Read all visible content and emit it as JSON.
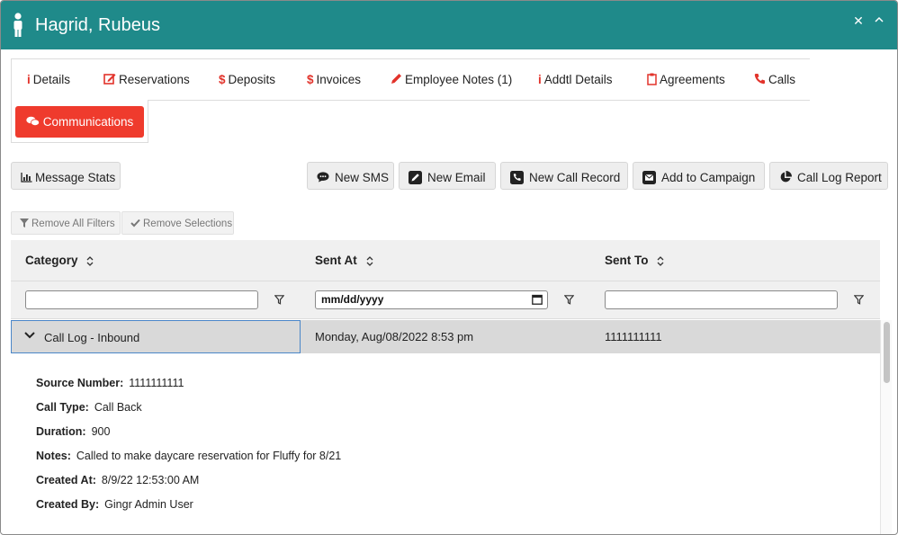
{
  "header": {
    "title": "Hagrid, Rubeus"
  },
  "tabs": [
    {
      "label": "Details",
      "icon": "info-icon"
    },
    {
      "label": "Reservations",
      "icon": "edit-icon"
    },
    {
      "label": "Deposits",
      "icon": "dollar-icon"
    },
    {
      "label": "Invoices",
      "icon": "dollar-icon"
    },
    {
      "label": "Employee Notes (1)",
      "icon": "pencil-icon"
    },
    {
      "label": "Addtl Details",
      "icon": "info-icon"
    },
    {
      "label": "Agreements",
      "icon": "clipboard-icon"
    },
    {
      "label": "Calls",
      "icon": "phone-icon"
    },
    {
      "label": "Communications",
      "icon": "comments-icon",
      "active": true
    }
  ],
  "toolbar": {
    "message_stats": "Message Stats",
    "new_sms": "New SMS",
    "new_email": "New Email",
    "new_call_record": "New Call Record",
    "add_to_campaign": "Add to Campaign",
    "call_log_report": "Call Log Report"
  },
  "filters": {
    "remove_all": "Remove All Filters",
    "remove_selections": "Remove Selections"
  },
  "table": {
    "columns": [
      "Category",
      "Sent At",
      "Sent To"
    ],
    "date_placeholder": "mm/dd/yyyy",
    "rows": [
      {
        "category": "Call Log - Inbound",
        "sent_at": "Monday, Aug/08/2022 8:53 pm",
        "sent_to": "1111111111",
        "expanded": true
      }
    ]
  },
  "detail": [
    {
      "key": "Source Number:",
      "value": "1111111111"
    },
    {
      "key": "Call Type:",
      "value": "Call Back"
    },
    {
      "key": "Duration:",
      "value": "900"
    },
    {
      "key": "Notes:",
      "value": "Called to make daycare reservation for Fluffy for 8/21"
    },
    {
      "key": "Created At:",
      "value": "8/9/22 12:53:00 AM"
    },
    {
      "key": "Created By:",
      "value": "Gingr Admin User"
    }
  ],
  "colors": {
    "header": "#1f8a8a",
    "accent": "#ef3b2d",
    "icon_red": "#e2332b",
    "selection_border": "#4a86c8"
  }
}
